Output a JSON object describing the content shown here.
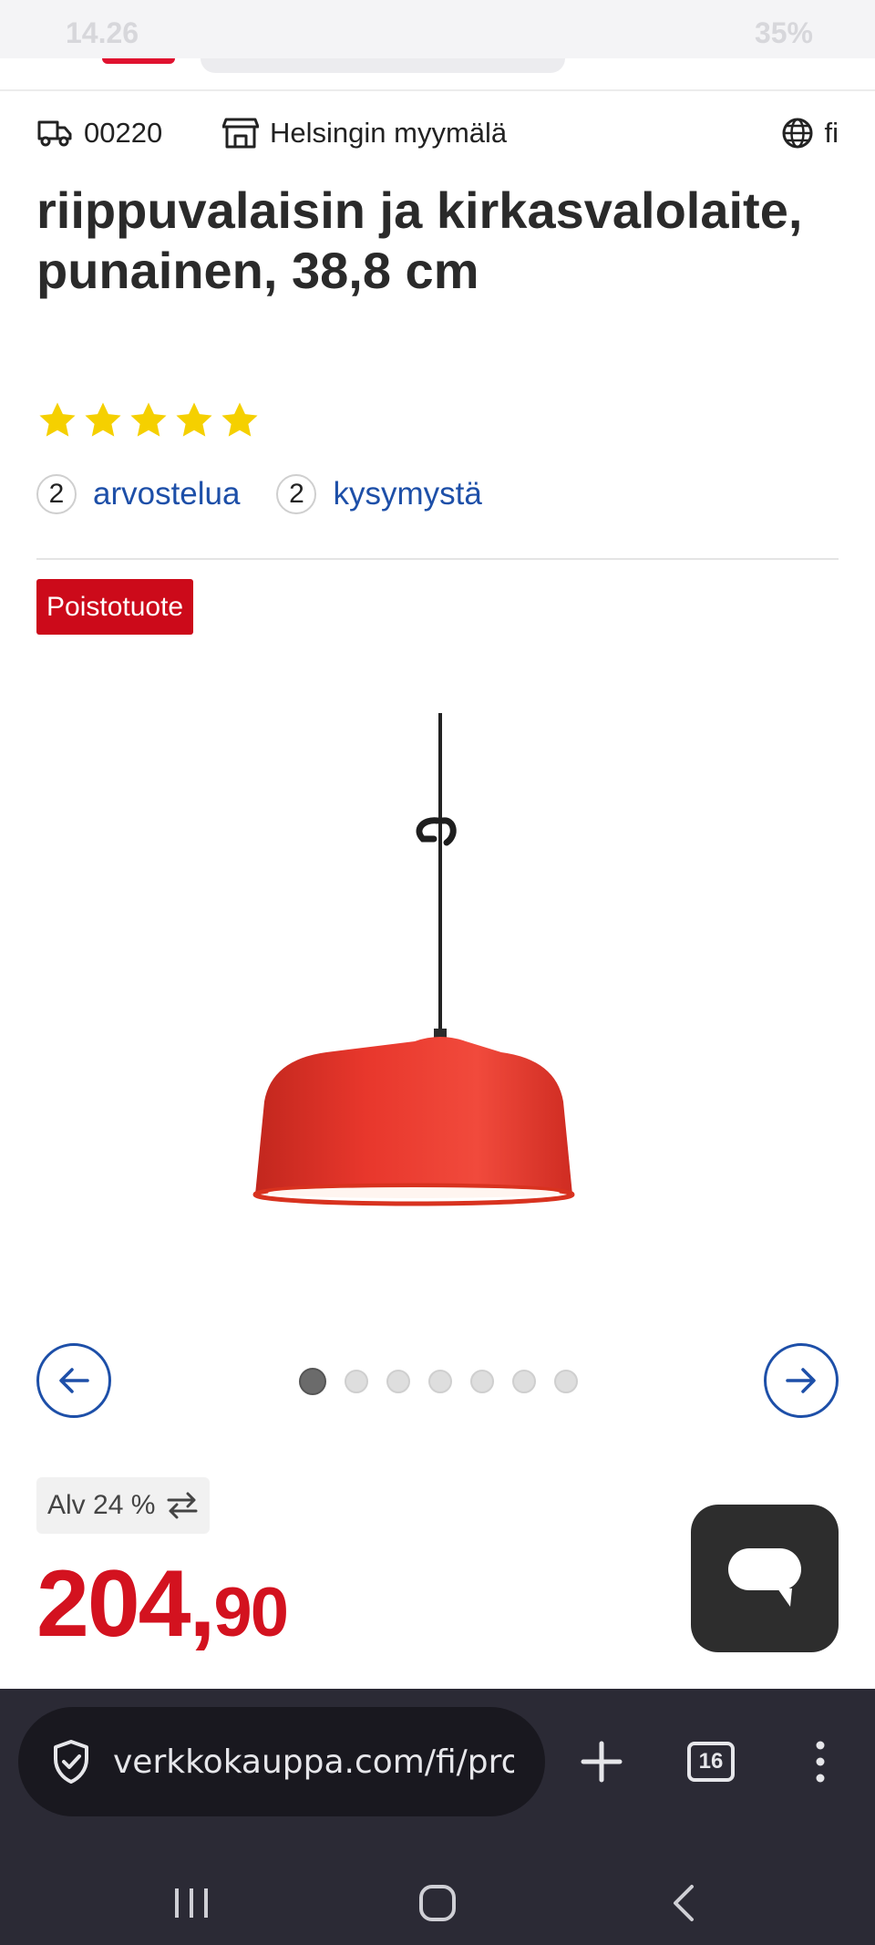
{
  "status_bar": {
    "time": "14.26",
    "battery": "35%"
  },
  "location": {
    "postal_code": "00220",
    "store": "Helsingin myymälä",
    "language": "fi"
  },
  "product": {
    "title": "riippuvalaisin ja kirkasvalolaite, punainen, 38,8 cm",
    "rating_stars": 5,
    "reviews_count": "2",
    "reviews_label": "arvostelua",
    "questions_count": "2",
    "questions_label": "kysymystä",
    "badge": "Poistotuote",
    "image_icon": "red-pendant-lamp",
    "color": "#e8372c"
  },
  "carousel": {
    "total": 7,
    "active": 1
  },
  "pricing": {
    "vat_label": "Alv 24 %",
    "price_integer": "204,",
    "price_decimal": "90",
    "price_color": "#d3121f"
  },
  "browser": {
    "url": "verkkokauppa.com/fi/product",
    "tabs_count": "16"
  },
  "icons": {
    "truck": "truck-icon",
    "store": "store-icon",
    "globe": "globe-icon",
    "chat": "chat-icon",
    "shield": "shield-check-icon"
  },
  "colors": {
    "accent": "#1d4fa8",
    "star": "#f5d000",
    "badge": "#cc0a1a"
  }
}
